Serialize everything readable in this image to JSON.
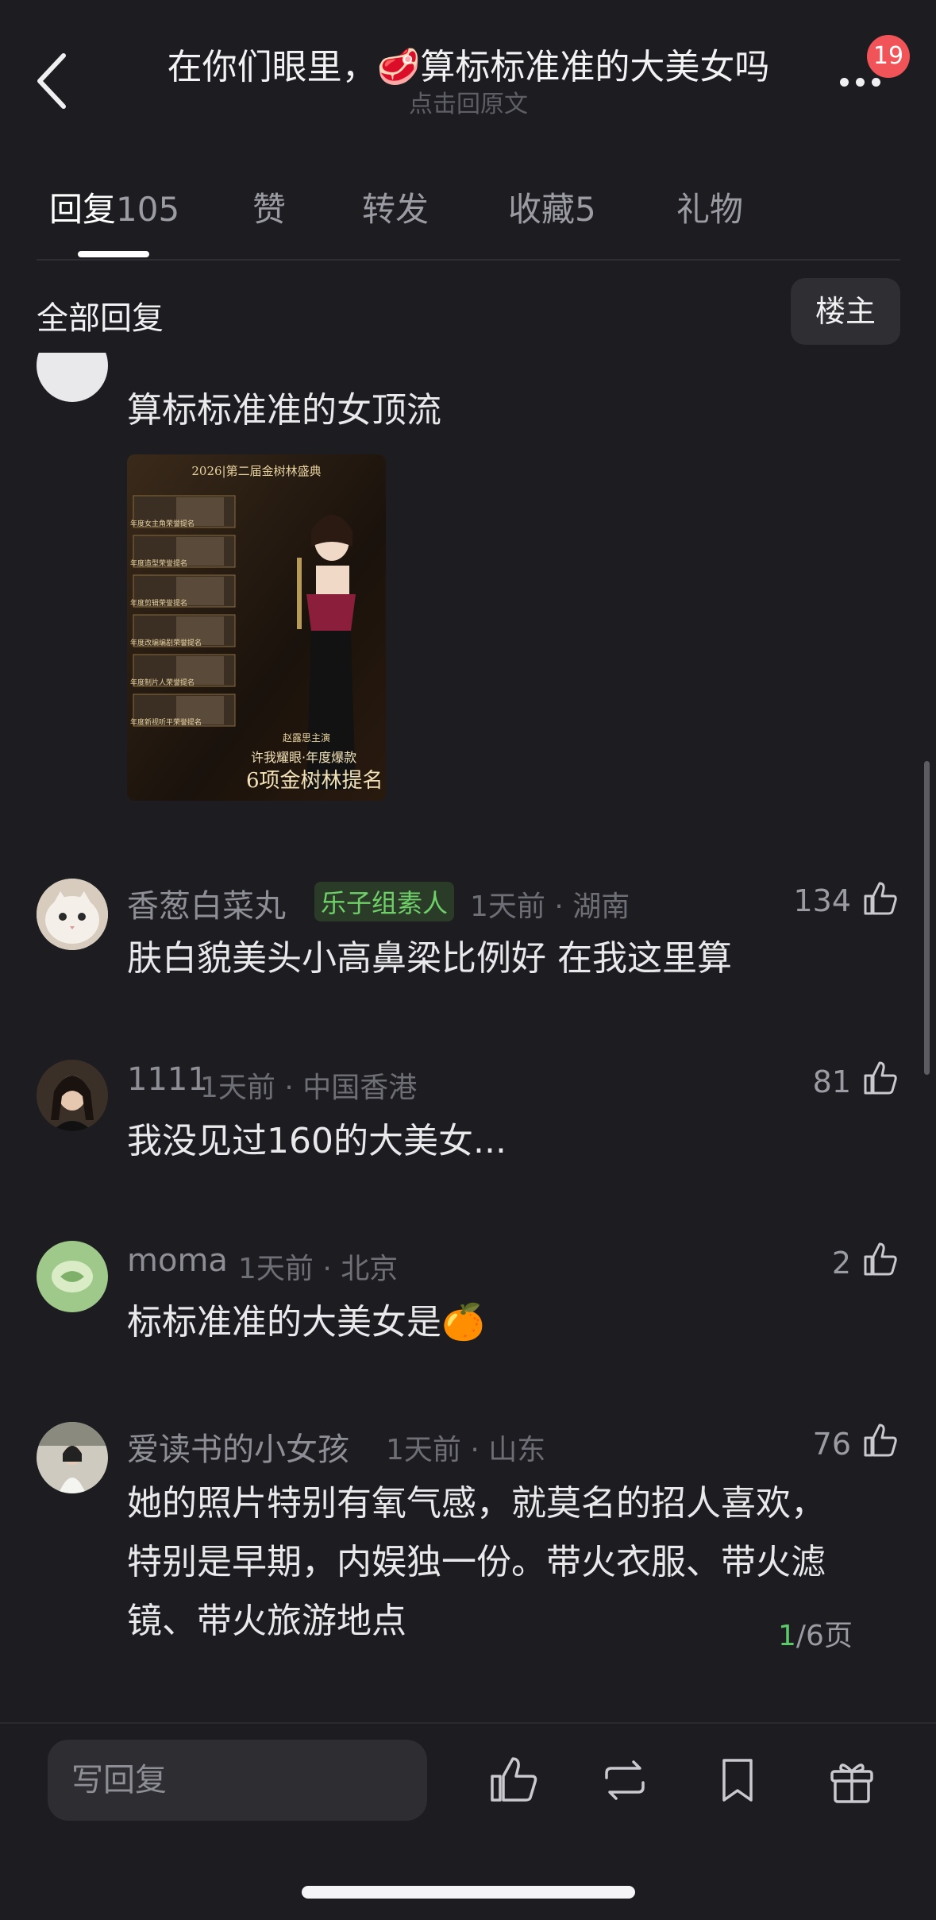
{
  "header": {
    "title": "在你们眼里，🥩算标标准准的大美女吗",
    "subtitle": "点击回原文",
    "notification_count": "19"
  },
  "tabs": [
    {
      "label": "回复",
      "count": "105"
    },
    {
      "label": "赞",
      "count": ""
    },
    {
      "label": "转发",
      "count": ""
    },
    {
      "label": "收藏",
      "count": "5"
    },
    {
      "label": "礼物",
      "count": ""
    }
  ],
  "section": {
    "title": "全部回复",
    "owner_button": "楼主"
  },
  "comments": [
    {
      "text": "算标标准准的女顶流",
      "image": {
        "title": "2026|第二届金树林盛典",
        "caption1": "许我耀眼·年度爆款",
        "caption2": "6项金树林提名",
        "name_tag": "赵露思主演",
        "rows": [
          "年度女主角荣誉提名",
          "年度造型荣誉提名",
          "年度剪辑荣誉提名",
          "年度改编编剧荣誉提名",
          "年度制片人荣誉提名",
          "年度新视听平荣誉提名"
        ]
      }
    },
    {
      "user": "香葱白菜丸",
      "tag": "乐子组素人",
      "meta": "1天前 · 湖南",
      "likes": "134",
      "lines": [
        "肤白貌美头小高鼻梁比例好 在我这里算"
      ]
    },
    {
      "user": "1111",
      "tag": "",
      "meta": "1天前 · 中国香港",
      "likes": "81",
      "lines": [
        "我没见过160的大美女..."
      ]
    },
    {
      "user": "moma",
      "tag": "",
      "meta": "1天前 · 北京",
      "likes": "2",
      "lines": [
        "标标准准的大美女是🍊"
      ]
    },
    {
      "user": "爱读书的小女孩",
      "tag": "",
      "meta": "1天前 · 山东",
      "likes": "76",
      "lines": [
        "她的照片特别有氧气感，就莫名的招人喜欢，",
        "特别是早期，内娱独一份。带火衣服、带火滤",
        "镜、带火旅游地点"
      ]
    }
  ],
  "pager": {
    "current": "1",
    "total": "/6页"
  },
  "bottom_bar": {
    "reply_placeholder": "写回复"
  },
  "colors": {
    "background": "#1d1d21",
    "tag_green": "#6fd06a",
    "badge_red": "#f05458"
  }
}
